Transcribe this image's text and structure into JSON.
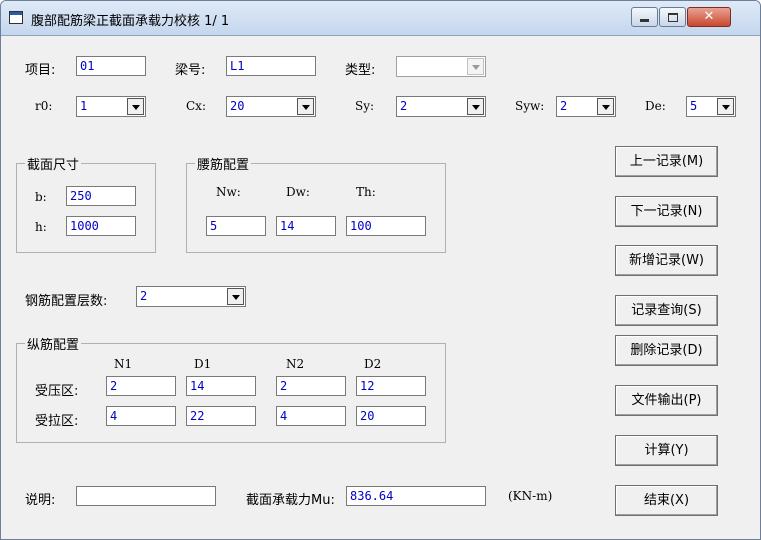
{
  "window": {
    "title": "腹部配筋梁正截面承载力校核 1/ 1"
  },
  "top": {
    "project_label": "项目:",
    "project_value": "01",
    "beam_label": "梁号:",
    "beam_value": "L1",
    "type_label": "类型:",
    "type_value": "",
    "r0_label": "r0:",
    "r0_value": "1",
    "cx_label": "Cx:",
    "cx_value": "20",
    "sy_label": "Sy:",
    "sy_value": "2",
    "syw_label": "Syw:",
    "syw_value": "2",
    "de_label": "De:",
    "de_value": "5"
  },
  "section": {
    "title": "截面尺寸",
    "b_label": "b:",
    "b_value": "250",
    "h_label": "h:",
    "h_value": "1000"
  },
  "waist": {
    "title": "腰筋配置",
    "nw_label": "Nw:",
    "dw_label": "Dw:",
    "th_label": "Th:",
    "nw_value": "5",
    "dw_value": "14",
    "th_value": "100"
  },
  "layers": {
    "label": "钢筋配置层数:",
    "value": "2"
  },
  "longitudinal": {
    "title": "纵筋配置",
    "headers": [
      "N1",
      "D1",
      "N2",
      "D2"
    ],
    "compression_label": "受压区:",
    "tension_label": "受拉区:",
    "compression": [
      "2",
      "14",
      "2",
      "12"
    ],
    "tension": [
      "4",
      "22",
      "4",
      "20"
    ]
  },
  "bottom": {
    "note_label": "说明:",
    "note_value": "",
    "mu_label": "截面承载力Mu:",
    "mu_value": "836.64",
    "mu_unit": "(KN-m)"
  },
  "buttons": {
    "prev": "上一记录(M)",
    "next": "下一记录(N)",
    "add": "新增记录(W)",
    "query": "记录查询(S)",
    "delete": "删除记录(D)",
    "export": "文件输出(P)",
    "calc": "计算(Y)",
    "exit": "结束(X)"
  }
}
